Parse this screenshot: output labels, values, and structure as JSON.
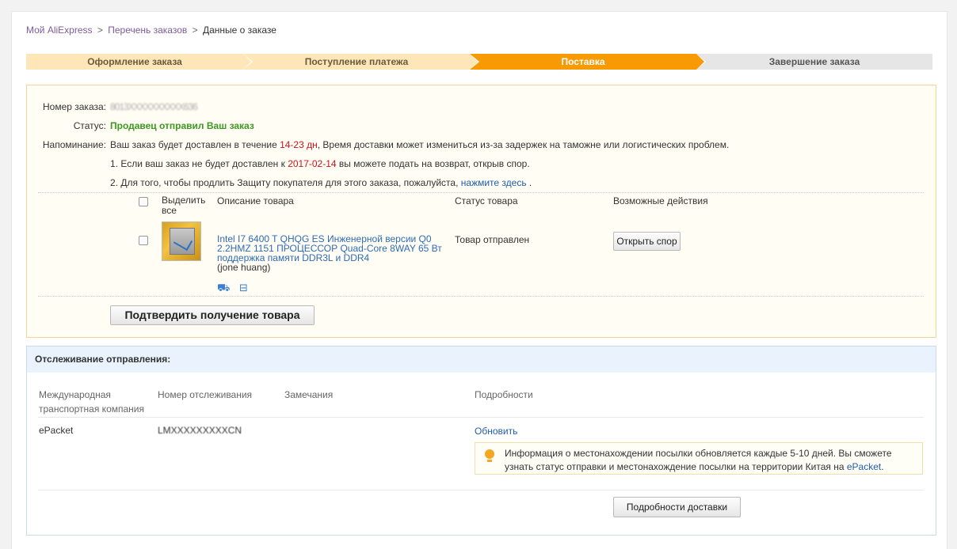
{
  "breadcrumb": {
    "link1": "Мой AliExpress",
    "sep1": ">",
    "link2": "Перечень заказов",
    "sep2": ">",
    "current": "Данные о заказе"
  },
  "steps": [
    {
      "label": "Оформление заказа"
    },
    {
      "label": "Поступление платежа"
    },
    {
      "label": "Поставка"
    },
    {
      "label": "Завершение заказа"
    }
  ],
  "order": {
    "number_label": "Номер заказа:",
    "number_value": "8013ХХХХХХХХХХ636",
    "status_label": "Статус:",
    "status_value": "Продавец отправил Ваш заказ",
    "reminder_label": "Напоминание:",
    "reminder_pre": "Ваш заказ будет доставлен в течение ",
    "reminder_days": "14-23 дн",
    "reminder_post": ", Время доставки может измениться из-за задержек на таможне или логистических проблем.",
    "note1_pre": "1. Если ваш заказ не будет доставлен к ",
    "note1_date": "2017-02-14",
    "note1_post": " вы можете подать на возврат, открыв спор.",
    "note2_pre": "2. Для того, чтобы продлить Защиту покупателя для этого заказа, пожалуйста, ",
    "note2_link": "нажмите здесь",
    "note2_post": " ."
  },
  "table": {
    "col_select": "Выделить все",
    "col_desc": "Описание товара",
    "col_status": "Статус товара",
    "col_actions": "Возможные действия"
  },
  "item": {
    "title": "Intel I7 6400 T QHQG ES Инженерной версии Q0 2.2HMZ 1151 ПРОЦЕССОР Quad-Core 8WAY 65 Вт поддержка памяти DDR3L и DDR4",
    "seller": "(jone huang)",
    "status": "Товар отправлен",
    "dispute_button": "Открыть спор",
    "icons": [
      "delivery-truck-icon",
      "return-box-icon"
    ]
  },
  "confirm_button": "Подтвердить получение товара",
  "tracking": {
    "header": "Отслеживание отправления:",
    "col_company": "Международная транспортная компания",
    "col_number": "Номер отслеживания",
    "col_notes": "Замечания",
    "col_details": "Подробности",
    "company": "ePacket",
    "number": "LMXXXXXXXXXCN",
    "update_link": "Обновить",
    "info_pre": "Информация о местонахождении посылки обновляется каждые 5-10 дней. Вы сможете узнать статус отправки и местонахождение посылки на территории Китая на ",
    "info_link": "ePacket",
    "info_post": ".",
    "details_button": "Подробности доставки"
  },
  "colors": {
    "step_done": "#fde7b8",
    "step_active": "#f89a03",
    "step_todo": "#e6e6e6",
    "status_green": "#3c9a1e",
    "highlight_red": "#d4111a",
    "link_blue": "#1f5eab"
  }
}
